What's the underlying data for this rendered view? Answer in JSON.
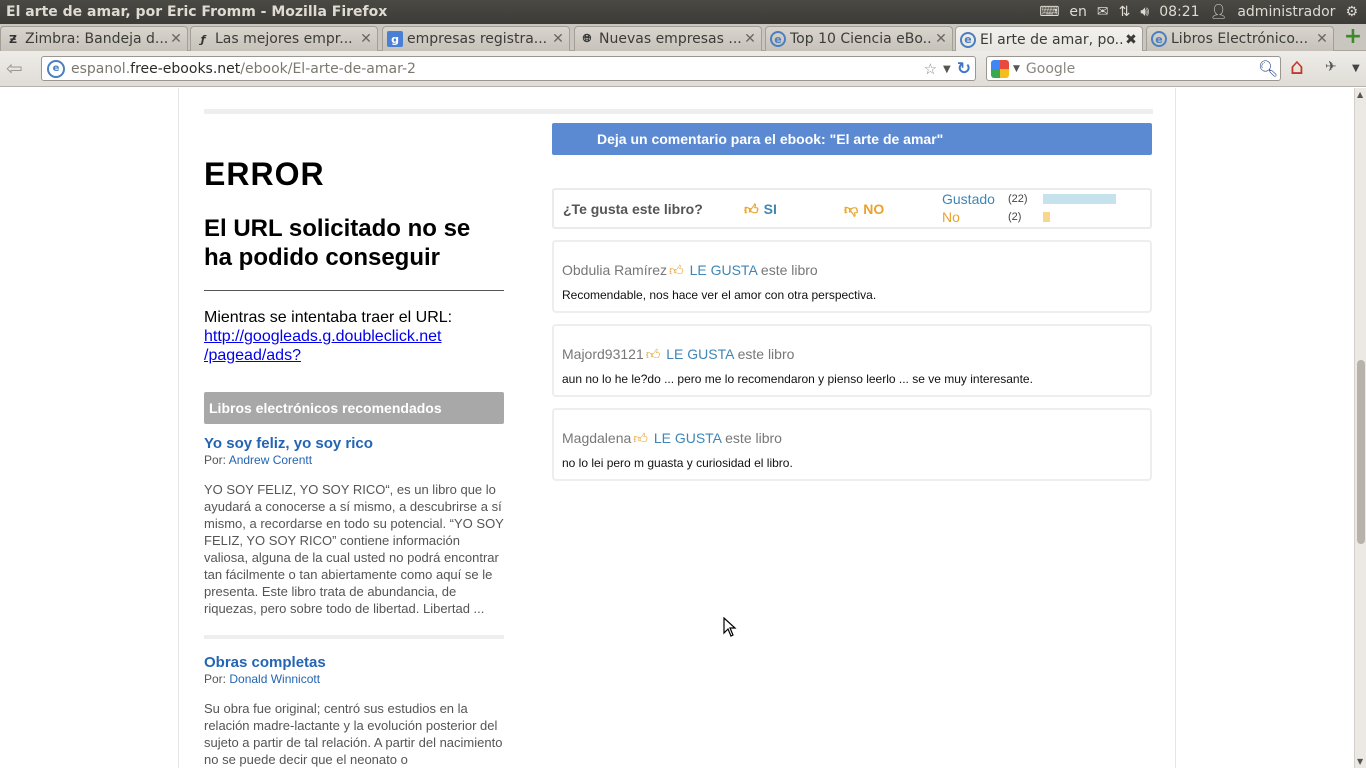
{
  "window": {
    "title": "El arte de amar, por Eric Fromm - Mozilla Firefox",
    "tray": {
      "lang": "en",
      "time": "08:21",
      "user": "administrador"
    }
  },
  "tabs": [
    {
      "label": "Zimbra: Bandeja d...",
      "icon": "zimbra-icon",
      "active": false
    },
    {
      "label": "Las mejores empr...",
      "icon": "yahoo-icon",
      "active": false
    },
    {
      "label": "empresas registra...",
      "icon": "google-icon",
      "active": false
    },
    {
      "label": "Nuevas empresas ...",
      "icon": "globe-icon",
      "active": false
    },
    {
      "label": "Top 10 Ciencia eBo...",
      "icon": "site-e-icon",
      "active": false
    },
    {
      "label": "El arte de amar, po...",
      "icon": "site-e-icon",
      "active": true
    },
    {
      "label": "Libros Electrónico...",
      "icon": "site-e-icon",
      "active": false
    }
  ],
  "navbar": {
    "url_prefix": "espanol.",
    "url_domain": "free-ebooks.net",
    "url_path": "/ebook/El-arte-de-amar-2",
    "search_placeholder": "Google"
  },
  "error": {
    "heading": "ERROR",
    "subheading": "El URL solicitado no se ha podido conseguir",
    "message": "Mientras se intentaba traer el URL:",
    "link_line1": "http://googleads.g.doubleclick.net",
    "link_line2": "/pagead/ads?"
  },
  "recommended": {
    "heading": "Libros electrónicos recomendados",
    "by_label": "Por:",
    "books": [
      {
        "title": "Yo soy feliz, yo soy rico",
        "author": "Andrew Corentt",
        "description": "YO SOY FELIZ, YO SOY RICO“, es un libro que lo ayudará a conocerse a sí mismo, a descubrirse a sí mismo, a recordarse en todo su potencial. “YO SOY FELIZ, YO SOY RICO” contiene información valiosa, alguna de la cual usted no podrá encontrar tan fácilmente o tan abiertamente como aquí se le presenta. Este libro trata de abundancia, de riquezas, pero sobre todo de libertad. Libertad ..."
      },
      {
        "title": "Obras completas",
        "author": "Donald Winnicott",
        "description": "Su obra fue original; centró sus estudios en la relación madre-lactante y la evolución posterior del sujeto a partir de tal relación. A partir del nacimiento no se puede decir que el neonato o"
      }
    ]
  },
  "comments": {
    "header": "Deja un comentario para el ebook: \"El arte de amar\"",
    "vote_question": "¿Te gusta este libro?",
    "vote_yes": "SI",
    "vote_no": "NO",
    "stats": [
      {
        "label": "Gustado",
        "count": "(22)",
        "value": 22,
        "color": "#c6e2ec",
        "label_color": "#3f86b5"
      },
      {
        "label": "No",
        "count": "(2)",
        "value": 2,
        "color": "#f9d68e",
        "label_color": "#e9a32b"
      }
    ],
    "like_label": "LE GUSTA",
    "like_suffix": "este libro",
    "items": [
      {
        "author": "Obdulia Ramírez",
        "text": "Recomendable, nos hace ver el amor con otra perspectiva."
      },
      {
        "author": "Majord93121",
        "text": "aun no lo he le?do ... pero me lo recomendaron y pienso leerlo ... se ve muy interesante."
      },
      {
        "author": "Magdalena",
        "text": "no lo lei pero m guasta y curiosidad el libro."
      }
    ]
  }
}
